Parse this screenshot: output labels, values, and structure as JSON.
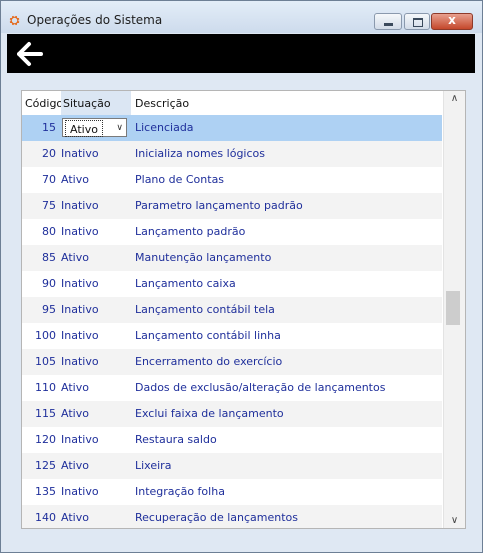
{
  "window": {
    "title": "Operações do Sistema",
    "close_glyph": "x"
  },
  "toolbar": {
    "back_icon": "arrow-left-icon"
  },
  "grid": {
    "headers": {
      "codigo": "Código",
      "situacao": "Situação",
      "descricao": "Descrição"
    },
    "selected_row": {
      "codigo": "15",
      "situacao": "Ativo",
      "descricao": "Licenciada"
    },
    "rows": [
      {
        "codigo": "20",
        "situacao": "Inativo",
        "descricao": "Inicializa nomes lógicos"
      },
      {
        "codigo": "70",
        "situacao": "Ativo",
        "descricao": "Plano de Contas"
      },
      {
        "codigo": "75",
        "situacao": "Inativo",
        "descricao": "Parametro lançamento padrão"
      },
      {
        "codigo": "80",
        "situacao": "Inativo",
        "descricao": "Lançamento padrão"
      },
      {
        "codigo": "85",
        "situacao": "Ativo",
        "descricao": "Manutenção lançamento"
      },
      {
        "codigo": "90",
        "situacao": "Inativo",
        "descricao": "Lançamento caixa"
      },
      {
        "codigo": "95",
        "situacao": "Inativo",
        "descricao": "Lançamento contábil tela"
      },
      {
        "codigo": "100",
        "situacao": "Inativo",
        "descricao": "Lançamento contábil linha"
      },
      {
        "codigo": "105",
        "situacao": "Inativo",
        "descricao": "Encerramento do exercício"
      },
      {
        "codigo": "110",
        "situacao": "Ativo",
        "descricao": "Dados de exclusão/alteração de lançamentos"
      },
      {
        "codigo": "115",
        "situacao": "Ativo",
        "descricao": "Exclui faixa de lançamento"
      },
      {
        "codigo": "120",
        "situacao": "Inativo",
        "descricao": "Restaura saldo"
      },
      {
        "codigo": "125",
        "situacao": "Ativo",
        "descricao": "Lixeira"
      },
      {
        "codigo": "135",
        "situacao": "Inativo",
        "descricao": "Integração folha"
      },
      {
        "codigo": "140",
        "situacao": "Ativo",
        "descricao": "Recuperação de lançamentos"
      }
    ]
  },
  "colors": {
    "selected_row": "#aed1f3",
    "row_text": "#1f2f9b",
    "toolbar": "#000000"
  }
}
